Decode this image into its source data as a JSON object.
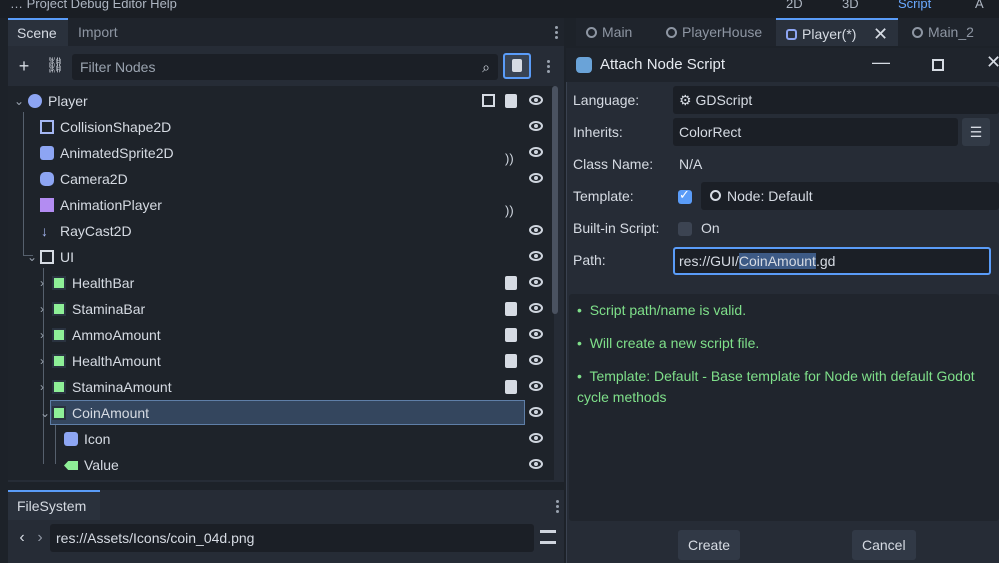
{
  "topbar": {
    "menu_text": "…  Project  Debug  Editor  Help",
    "mode_2d": "2D",
    "mode_3d": "3D",
    "mode_script": "Script",
    "mode_asset": "A"
  },
  "scene_dock": {
    "tabs": [
      "Scene",
      "Import"
    ],
    "filter_placeholder": "Filter Nodes",
    "nodes": [
      {
        "label": "Player"
      },
      {
        "label": "CollisionShape2D"
      },
      {
        "label": "AnimatedSprite2D"
      },
      {
        "label": "Camera2D"
      },
      {
        "label": "AnimationPlayer"
      },
      {
        "label": "RayCast2D"
      },
      {
        "label": "UI"
      },
      {
        "label": "HealthBar"
      },
      {
        "label": "StaminaBar"
      },
      {
        "label": "AmmoAmount"
      },
      {
        "label": "HealthAmount"
      },
      {
        "label": "StaminaAmount"
      },
      {
        "label": "CoinAmount"
      },
      {
        "label": "Icon"
      },
      {
        "label": "Value"
      }
    ]
  },
  "filesystem": {
    "tab": "FileSystem",
    "path": "res://Assets/Icons/coin_04d.png"
  },
  "editor_tabs": [
    {
      "label": "Main"
    },
    {
      "label": "PlayerHouse"
    },
    {
      "label": "Player(*)"
    },
    {
      "label": "Main_2"
    }
  ],
  "dialog": {
    "title": "Attach Node Script",
    "language_label": "Language:",
    "language_value": "GDScript",
    "inherits_label": "Inherits:",
    "inherits_value": "ColorRect",
    "classname_label": "Class Name:",
    "classname_value": "N/A",
    "template_label": "Template:",
    "template_value": "Node: Default",
    "builtin_label": "Built-in Script:",
    "builtin_value": "On",
    "path_label": "Path:",
    "path_prefix": "res://GUI/",
    "path_selected": "CoinAmount",
    "path_suffix": ".gd",
    "messages": [
      "Script path/name is valid.",
      "Will create a new script file.",
      "Template: Default - Base template for Node with default Godot",
      "cycle methods"
    ],
    "create_label": "Create",
    "cancel_label": "Cancel"
  },
  "colors": {
    "accent": "#5a9cf8",
    "valid_text": "#7fe08a",
    "control_icon": "#8eef97"
  }
}
